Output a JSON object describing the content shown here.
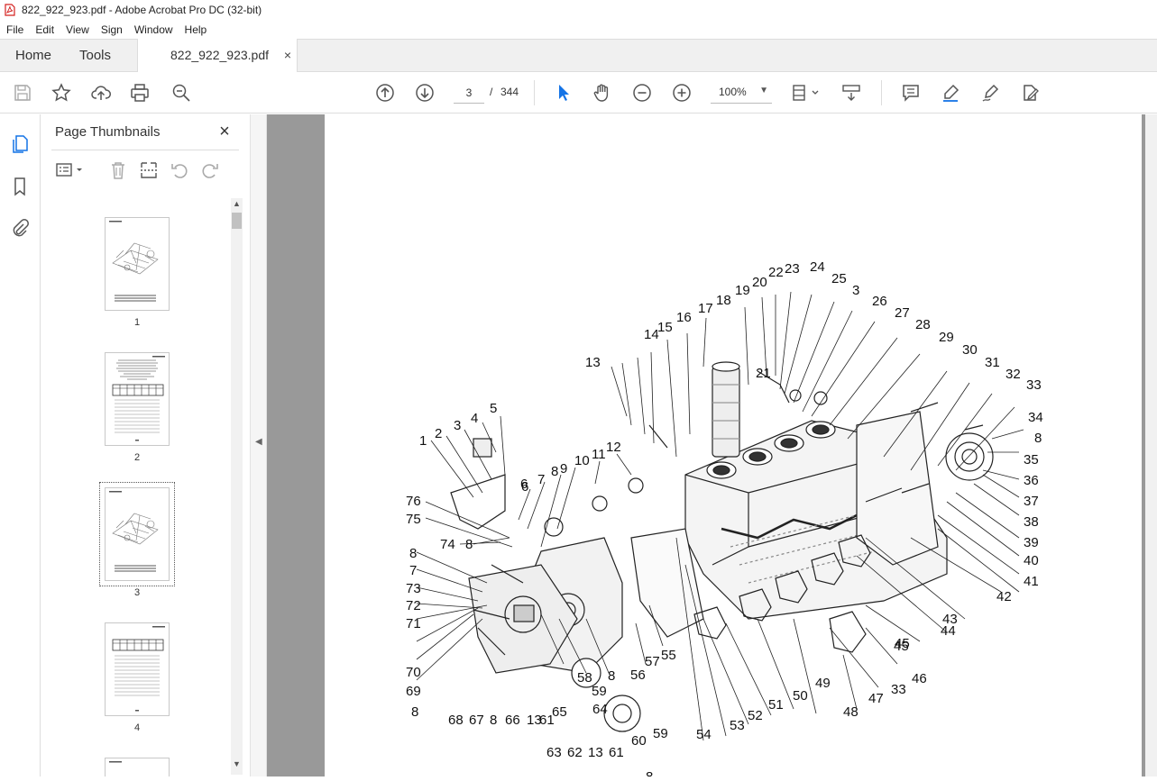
{
  "window": {
    "title": "822_922_923.pdf - Adobe Acrobat Pro DC (32-bit)"
  },
  "menu": {
    "items": [
      "File",
      "Edit",
      "View",
      "Sign",
      "Window",
      "Help"
    ]
  },
  "tabs": {
    "home": "Home",
    "tools": "Tools",
    "document": "822_922_923.pdf",
    "close": "×"
  },
  "toolbar": {
    "current_page": "3",
    "page_separator": "/",
    "total_pages": "344",
    "zoom": "100%"
  },
  "panel": {
    "title": "Page Thumbnails",
    "close": "×",
    "thumbnails": [
      {
        "label": "1"
      },
      {
        "label": "2"
      },
      {
        "label": "3",
        "selected": true
      },
      {
        "label": "4"
      }
    ]
  },
  "diagram": {
    "callouts": [
      "1",
      "2",
      "3",
      "4",
      "5",
      "6",
      "7",
      "8",
      "9",
      "10",
      "11",
      "12",
      "13",
      "14",
      "15",
      "16",
      "17",
      "18",
      "19",
      "20",
      "21",
      "22",
      "23",
      "24",
      "25",
      "3",
      "26",
      "27",
      "28",
      "29",
      "30",
      "31",
      "32",
      "33",
      "34",
      "8",
      "35",
      "36",
      "37",
      "38",
      "39",
      "40",
      "41",
      "42",
      "43",
      "44",
      "45",
      "46",
      "33",
      "47",
      "48",
      "49",
      "50",
      "51",
      "52",
      "53",
      "54",
      "55",
      "56",
      "57",
      "8",
      "58",
      "59",
      "60",
      "61",
      "13",
      "62",
      "63",
      "64",
      "59",
      "65",
      "61",
      "13",
      "66",
      "8",
      "67",
      "68",
      "8",
      "69",
      "70",
      "71",
      "72",
      "73",
      "7",
      "8",
      "74",
      "8",
      "75",
      "76",
      "45",
      "6",
      "8"
    ]
  },
  "colors": {
    "accent": "#1473e6",
    "doc_background": "#999999",
    "panel_background": "#ffffff"
  }
}
